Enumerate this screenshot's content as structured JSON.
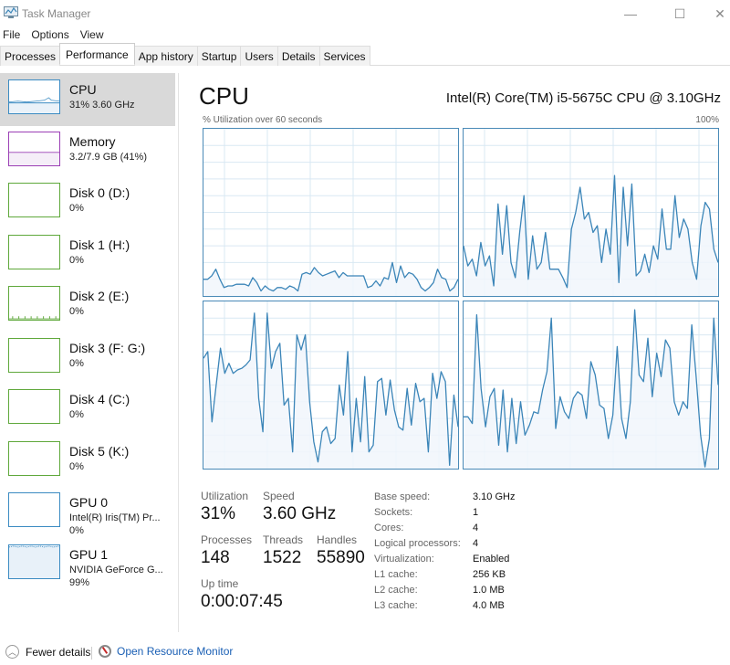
{
  "window": {
    "title": "Task Manager",
    "controls": {
      "minimize": "—",
      "maximize": "☐",
      "close": "✕"
    }
  },
  "menu": [
    "File",
    "Options",
    "View"
  ],
  "tabs": [
    "Processes",
    "Performance",
    "App history",
    "Startup",
    "Users",
    "Details",
    "Services"
  ],
  "active_tab": "Performance",
  "sidebar": {
    "items": [
      {
        "name": "CPU",
        "lines": [
          "31% 3.60 GHz"
        ],
        "color": "#3b8bc2",
        "selected": true
      },
      {
        "name": "Memory",
        "lines": [
          "3.2/7.9 GB (41%)"
        ],
        "color": "#9b3fb5",
        "selected": false
      },
      {
        "name": "Disk 0 (D:)",
        "lines": [
          "0%"
        ],
        "color": "#5fa83b",
        "selected": false
      },
      {
        "name": "Disk 1 (H:)",
        "lines": [
          "0%"
        ],
        "color": "#5fa83b",
        "selected": false
      },
      {
        "name": "Disk 2 (E:)",
        "lines": [
          "0%"
        ],
        "color": "#5fa83b",
        "selected": false
      },
      {
        "name": "Disk 3 (F: G:)",
        "lines": [
          "0%"
        ],
        "color": "#5fa83b",
        "selected": false
      },
      {
        "name": "Disk 4 (C:)",
        "lines": [
          "0%"
        ],
        "color": "#5fa83b",
        "selected": false
      },
      {
        "name": "Disk 5 (K:)",
        "lines": [
          "0%"
        ],
        "color": "#5fa83b",
        "selected": false
      },
      {
        "name": "GPU 0",
        "lines": [
          "Intel(R) Iris(TM) Pr...",
          "0%"
        ],
        "color": "#3b8bc2",
        "selected": false
      },
      {
        "name": "GPU 1",
        "lines": [
          "NVIDIA GeForce G...",
          "99%"
        ],
        "color": "#3b8bc2",
        "selected": false
      }
    ]
  },
  "main": {
    "title": "CPU",
    "model": "Intel(R) Core(TM) i5-5675C CPU @ 3.10GHz",
    "graph_label": "% Utilization over 60 seconds",
    "graph_max_label": "100%"
  },
  "stats": {
    "utilization": {
      "label": "Utilization",
      "value": "31%"
    },
    "speed": {
      "label": "Speed",
      "value": "3.60 GHz"
    },
    "processes": {
      "label": "Processes",
      "value": "148"
    },
    "threads": {
      "label": "Threads",
      "value": "1522"
    },
    "handles": {
      "label": "Handles",
      "value": "55890"
    },
    "uptime": {
      "label": "Up time",
      "value": "0:00:07:45"
    }
  },
  "specs": [
    {
      "key": "Base speed:",
      "value": "3.10 GHz"
    },
    {
      "key": "Sockets:",
      "value": "1"
    },
    {
      "key": "Cores:",
      "value": "4"
    },
    {
      "key": "Logical processors:",
      "value": "4"
    },
    {
      "key": "Virtualization:",
      "value": "Enabled"
    },
    {
      "key": "L1 cache:",
      "value": "256 KB"
    },
    {
      "key": "L2 cache:",
      "value": "1.0 MB"
    },
    {
      "key": "L3 cache:",
      "value": "4.0 MB"
    }
  ],
  "footer": {
    "fewer_details": "Fewer details",
    "open_resource_monitor": "Open Resource Monitor"
  },
  "colors": {
    "cpu_line": "#3b85b8",
    "cpu_fill": "#f1f6fb",
    "grid": "#d9e8f3",
    "memory": "#9b3fb5",
    "disk": "#5fa83b",
    "link": "#1a5fb4"
  },
  "chart_data": {
    "type": "line",
    "title": "% Utilization over 60 seconds",
    "ylim": [
      0,
      100
    ],
    "xlabel": "seconds",
    "ylabel": "% Utilization",
    "grid": true,
    "series": [
      {
        "name": "Core 0",
        "values": [
          10,
          10,
          12,
          16,
          10,
          5,
          6,
          6,
          7,
          7,
          7,
          6,
          11,
          8,
          3,
          6,
          4,
          3,
          5,
          5,
          4,
          6,
          5,
          3,
          13,
          14,
          13,
          17,
          14,
          12,
          13,
          14,
          15,
          11,
          14,
          12,
          12,
          12,
          12,
          12,
          5,
          6,
          9,
          6,
          11,
          10,
          20,
          8,
          18,
          11,
          14,
          13,
          10,
          5,
          3,
          5,
          8,
          16,
          11,
          10,
          3,
          5,
          10
        ]
      },
      {
        "name": "Core 1",
        "values": [
          30,
          18,
          22,
          12,
          32,
          18,
          24,
          6,
          55,
          25,
          54,
          20,
          11,
          38,
          60,
          10,
          36,
          16,
          20,
          38,
          16,
          16,
          16,
          11,
          5,
          40,
          50,
          65,
          46,
          50,
          38,
          42,
          20,
          40,
          25,
          72,
          8,
          65,
          30,
          67,
          12,
          15,
          25,
          14,
          30,
          22,
          52,
          28,
          28,
          60,
          35,
          46,
          40,
          20,
          10,
          42,
          56,
          52,
          28,
          20
        ]
      },
      {
        "name": "Core 2",
        "values": [
          66,
          70,
          28,
          50,
          72,
          57,
          63,
          57,
          59,
          60,
          62,
          65,
          93,
          42,
          22,
          93,
          60,
          70,
          75,
          38,
          42,
          10,
          80,
          71,
          80,
          40,
          16,
          4,
          22,
          25,
          15,
          18,
          50,
          32,
          70,
          10,
          42,
          16,
          55,
          10,
          14,
          52,
          54,
          32,
          53,
          35,
          25,
          23,
          48,
          26,
          51,
          40,
          42,
          10,
          57,
          42,
          58,
          52,
          2,
          44,
          25
        ]
      },
      {
        "name": "Core 3",
        "values": [
          31,
          31,
          27,
          92,
          48,
          25,
          43,
          48,
          14,
          47,
          10,
          42,
          15,
          40,
          20,
          26,
          34,
          33,
          47,
          58,
          90,
          24,
          43,
          34,
          30,
          42,
          46,
          44,
          30,
          64,
          56,
          38,
          36,
          18,
          32,
          73,
          30,
          18,
          40,
          95,
          56,
          52,
          78,
          43,
          69,
          55,
          77,
          72,
          40,
          32,
          40,
          36,
          86,
          55,
          20,
          1,
          18,
          90,
          50
        ]
      }
    ]
  }
}
